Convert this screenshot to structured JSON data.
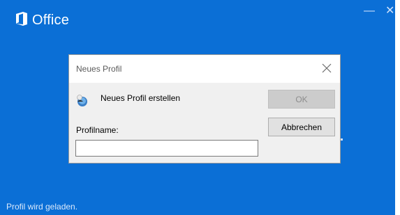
{
  "splash": {
    "app_title": "Office",
    "status_text": "Profil wird geladen.",
    "accent_color": "#0b6fd6",
    "window_controls": [
      "minimize-icon",
      "close-icon"
    ]
  },
  "dialog": {
    "title": "Neues Profil",
    "message": "Neues Profil erstellen",
    "profile_name_label": "Profilname:",
    "profile_name_value": "",
    "ok_label": "OK",
    "cancel_label": "Abbrechen",
    "icon": "profile-icon"
  }
}
